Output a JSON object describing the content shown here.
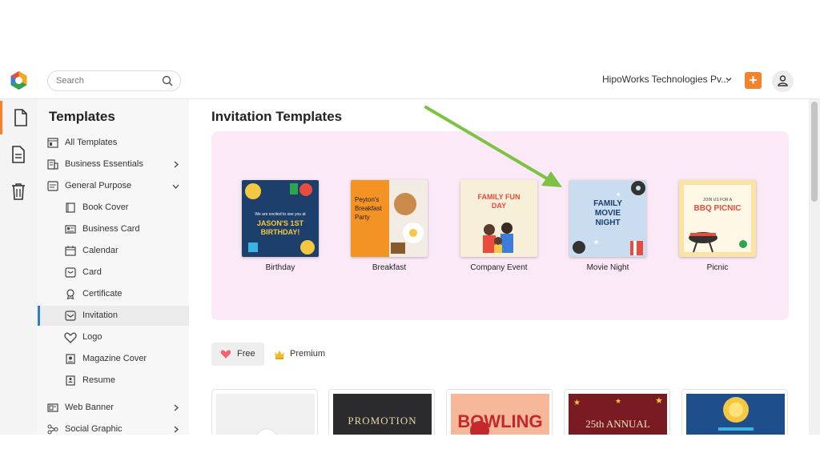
{
  "header": {
    "search": {
      "placeholder": "Search"
    },
    "organization": "HipoWorks Technologies Pv...",
    "plus_label": "+"
  },
  "sidebar": {
    "title": "Templates",
    "items": [
      {
        "label": "All Templates",
        "icon": "all-templates-icon",
        "level": 0
      },
      {
        "label": "Business Essentials",
        "icon": "building-icon",
        "level": 0,
        "expandable": true
      },
      {
        "label": "General Purpose",
        "icon": "general-purpose-icon",
        "level": 0,
        "expanded": true
      },
      {
        "label": "Book Cover",
        "icon": "book-icon",
        "level": 1
      },
      {
        "label": "Business Card",
        "icon": "business-card-icon",
        "level": 1
      },
      {
        "label": "Calendar",
        "icon": "calendar-icon",
        "level": 1
      },
      {
        "label": "Card",
        "icon": "card-icon",
        "level": 1
      },
      {
        "label": "Certificate",
        "icon": "certificate-icon",
        "level": 1
      },
      {
        "label": "Invitation",
        "icon": "invitation-icon",
        "level": 1,
        "active": true
      },
      {
        "label": "Logo",
        "icon": "heart-icon",
        "level": 1
      },
      {
        "label": "Magazine Cover",
        "icon": "magazine-icon",
        "level": 1
      },
      {
        "label": "Resume",
        "icon": "resume-icon",
        "level": 1
      },
      {
        "label": "Web Banner",
        "icon": "web-banner-icon",
        "level": 0,
        "expandable": true
      },
      {
        "label": "Social Graphic",
        "icon": "social-graphic-icon",
        "level": 0,
        "expandable": true
      }
    ]
  },
  "main": {
    "title": "Invitation Templates",
    "categories": [
      {
        "label": "Birthday",
        "thumb": {
          "lines": [
            "We are excited to see you at",
            "JASON'S 1ST",
            "BIRTHDAY!"
          ]
        }
      },
      {
        "label": "Breakfast",
        "thumb": {
          "lines": [
            "Peyton's",
            "Breakfast",
            "Party"
          ]
        }
      },
      {
        "label": "Company Event",
        "thumb": {
          "lines": [
            "FAMILY FUN",
            "DAY"
          ]
        }
      },
      {
        "label": "Movie Night",
        "thumb": {
          "lines": [
            "FAMILY",
            "MOVIE",
            "NIGHT"
          ]
        }
      },
      {
        "label": "Picnic",
        "thumb": {
          "lines": [
            "JOIN US FOR A",
            "BBQ PICNIC"
          ]
        }
      }
    ],
    "filters": {
      "free": "Free",
      "premium": "Premium"
    },
    "cards": [
      {
        "text": ""
      },
      {
        "text": "PROMOTION"
      },
      {
        "text": "BOWLING"
      },
      {
        "text": "25th ANNUAL"
      },
      {
        "text": ""
      }
    ]
  },
  "colors": {
    "accent": "#f5822a",
    "active_bar": "#2a7fd4",
    "banner_bg": "#fbe9f7",
    "arrow": "#7dc242"
  }
}
